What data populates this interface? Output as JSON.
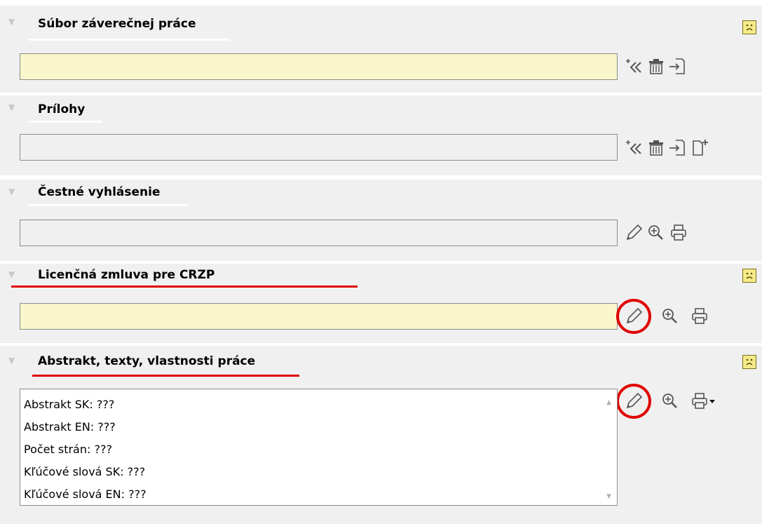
{
  "sections": [
    {
      "title": "Súbor záverečnej práce",
      "status_icon": "sad-face-icon",
      "actions": [
        "add-icon",
        "delete-icon",
        "import-icon"
      ]
    },
    {
      "title": "Prílohy",
      "actions": [
        "add-icon",
        "delete-icon",
        "import-icon",
        "new-file-icon"
      ]
    },
    {
      "title": "Čestné vyhlásenie",
      "actions": [
        "edit-icon",
        "zoom-icon",
        "print-icon"
      ]
    },
    {
      "title": "Licenčná zmluva pre CRZP",
      "status_icon": "sad-face-icon",
      "actions": [
        "edit-icon",
        "zoom-icon",
        "print-icon"
      ]
    },
    {
      "title": "Abstrakt, texty, vlastnosti práce",
      "status_icon": "sad-face-icon",
      "actions": [
        "edit-icon",
        "zoom-icon",
        "print-dropdown-icon"
      ],
      "lines": [
        "Abstrakt SK: ???",
        "Abstrakt EN: ???",
        "Počet strán: ???",
        "Kľúčové slová SK: ???",
        "Kľúčové slová EN: ???"
      ]
    }
  ],
  "colors": {
    "highlight_field": "#f9f6cc",
    "annotation_red": "#e00000",
    "panel_bg": "#f0f0f0"
  }
}
